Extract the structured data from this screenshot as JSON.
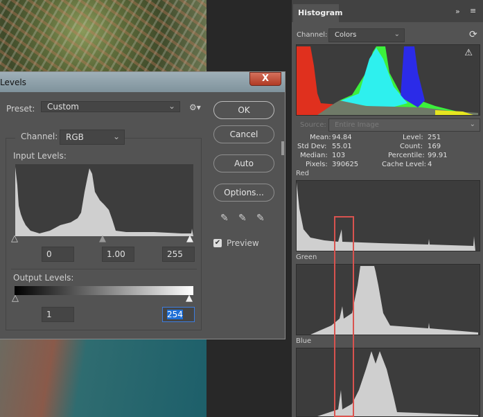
{
  "dialog": {
    "title": "Levels",
    "close": "X",
    "preset_label": "Preset:",
    "preset_value": "Custom",
    "channel_label": "Channel:",
    "channel_value": "RGB",
    "input_label": "Input Levels:",
    "input_black": "0",
    "input_gamma": "1.00",
    "input_white": "255",
    "output_label": "Output Levels:",
    "output_black": "1",
    "output_white": "254",
    "buttons": {
      "ok": "OK",
      "cancel": "Cancel",
      "auto": "Auto",
      "options": "Options..."
    },
    "preview_label": "Preview",
    "preview_checked": true
  },
  "panel": {
    "tab": "Histogram",
    "channel_label": "Channel:",
    "channel_value": "Colors",
    "source_label": "Source:",
    "source_value": "Entire Image",
    "stats": {
      "mean_label": "Mean:",
      "mean": "94.84",
      "std_label": "Std Dev:",
      "std": "55.01",
      "median_label": "Median:",
      "median": "103",
      "pixels_label": "Pixels:",
      "pixels": "390625",
      "level_label": "Level:",
      "level": "251",
      "count_label": "Count:",
      "count": "169",
      "percentile_label": "Percentile:",
      "percentile": "99.91",
      "cache_label": "Cache Level:",
      "cache": "4"
    },
    "channels": {
      "red": "Red",
      "green": "Green",
      "blue": "Blue"
    }
  },
  "colors": {
    "highlight_box": "#d9534f",
    "selection": "#1f6fd6"
  }
}
